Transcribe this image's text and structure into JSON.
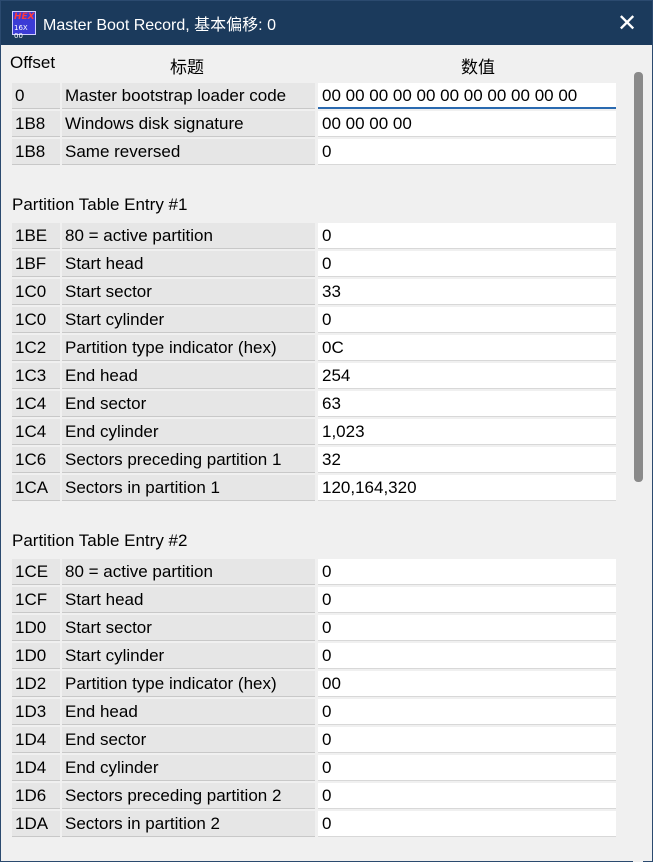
{
  "window": {
    "title": "Master Boot Record, 基本偏移: 0",
    "icon_top": "HEX",
    "icon_bottom": "16X 00",
    "close_glyph": "✕"
  },
  "header": {
    "offset": "Offset",
    "title": "标题",
    "value": "数值"
  },
  "mbr_rows": [
    {
      "offset": "0",
      "title": "Master bootstrap loader code",
      "value": "00 00 00 00 00 00 00 00 00 00 00"
    },
    {
      "offset": "1B8",
      "title": "Windows disk signature",
      "value": "00 00 00 00"
    },
    {
      "offset": "1B8",
      "title": "Same reversed",
      "value": "0"
    }
  ],
  "partition1": {
    "heading": "Partition Table Entry #1",
    "rows": [
      {
        "offset": "1BE",
        "title": "80 = active partition",
        "value": "0"
      },
      {
        "offset": "1BF",
        "title": "Start head",
        "value": "0"
      },
      {
        "offset": "1C0",
        "title": "Start sector",
        "value": "33"
      },
      {
        "offset": "1C0",
        "title": "Start cylinder",
        "value": "0"
      },
      {
        "offset": "1C2",
        "title": "Partition type indicator (hex)",
        "value": "0C"
      },
      {
        "offset": "1C3",
        "title": "End head",
        "value": "254"
      },
      {
        "offset": "1C4",
        "title": "End sector",
        "value": "63"
      },
      {
        "offset": "1C4",
        "title": "End cylinder",
        "value": "1,023"
      },
      {
        "offset": "1C6",
        "title": "Sectors preceding partition 1",
        "value": "32"
      },
      {
        "offset": "1CA",
        "title": "Sectors in partition 1",
        "value": "120,164,320"
      }
    ]
  },
  "partition2": {
    "heading": "Partition Table Entry #2",
    "rows": [
      {
        "offset": "1CE",
        "title": "80 = active partition",
        "value": "0"
      },
      {
        "offset": "1CF",
        "title": "Start head",
        "value": "0"
      },
      {
        "offset": "1D0",
        "title": "Start sector",
        "value": "0"
      },
      {
        "offset": "1D0",
        "title": "Start cylinder",
        "value": "0"
      },
      {
        "offset": "1D2",
        "title": "Partition type indicator (hex)",
        "value": "00"
      },
      {
        "offset": "1D3",
        "title": "End head",
        "value": "0"
      },
      {
        "offset": "1D4",
        "title": "End sector",
        "value": "0"
      },
      {
        "offset": "1D4",
        "title": "End cylinder",
        "value": "0"
      },
      {
        "offset": "1D6",
        "title": "Sectors preceding partition 2",
        "value": "0"
      },
      {
        "offset": "1DA",
        "title": "Sectors in partition 2",
        "value": "0"
      }
    ]
  }
}
